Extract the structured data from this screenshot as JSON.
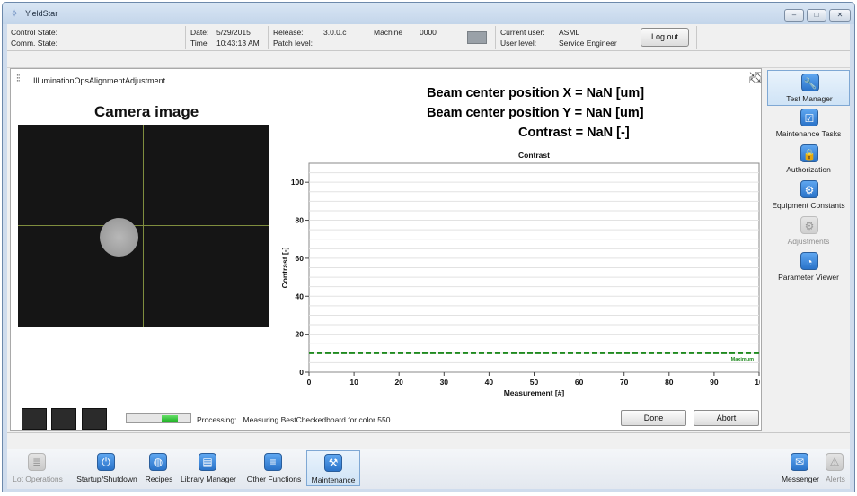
{
  "window": {
    "title": "YieldStar",
    "min_symbol": "–",
    "max_symbol": "□",
    "close_symbol": "✕"
  },
  "status": {
    "control_state_label": "Control State:",
    "comm_state_label": "Comm. State:",
    "date_label": "Date:",
    "date_value": "5/29/2015",
    "time_label": "Time",
    "time_value": "10:43:13 AM",
    "release_label": "Release:",
    "release_value": "3.0.0.c",
    "patch_label": "Patch level:",
    "machine_label": "Machine",
    "machine_value": "0000",
    "current_user_label": "Current user:",
    "current_user_value": "ASML",
    "user_level_label": "User level:",
    "user_level_value": "Service Engineer",
    "logout_label": "Log out"
  },
  "panel": {
    "title": "IlluminationOpsAlignmentAdjustment",
    "icon": "sliders-icon",
    "readouts": {
      "beam_x": "Beam center position X = NaN [um]",
      "beam_y": "Beam center position Y = NaN [um]",
      "contrast": "Contrast = NaN [-]"
    },
    "camera_title": "Camera image",
    "processing_label": "Processing:",
    "processing_text": "Measuring BestCheckedboard for color 550.",
    "progress_fraction": 0.25,
    "done_label": "Done",
    "abort_label": "Abort"
  },
  "chart_data": {
    "type": "line",
    "title": "Contrast",
    "xlabel": "Measurement [#]",
    "ylabel": "Contrast [-]",
    "xlim": [
      0,
      100
    ],
    "ylim": [
      0,
      110
    ],
    "x_ticks": [
      0,
      10,
      20,
      30,
      40,
      50,
      60,
      70,
      80,
      90,
      100
    ],
    "x_tick_labels": [
      "0",
      "10",
      "20",
      "30",
      "40",
      "50",
      "60",
      "70",
      "80",
      "90",
      "10"
    ],
    "y_ticks": [
      0,
      20,
      40,
      60,
      80,
      100
    ],
    "grid": true,
    "series": [],
    "reference_lines": [
      {
        "name": "Maximum",
        "y": 10,
        "style": "dashed",
        "color": "#1f8a1f"
      }
    ]
  },
  "sidebar": {
    "items": [
      {
        "label": "Test Manager",
        "icon": "wrench-icon",
        "glyph": "🔧",
        "active": true,
        "enabled": true
      },
      {
        "label": "Maintenance Tasks",
        "icon": "checkbox-icon",
        "glyph": "☑",
        "active": false,
        "enabled": true
      },
      {
        "label": "Authorization",
        "icon": "lock-icon",
        "glyph": "🔒",
        "active": false,
        "enabled": true
      },
      {
        "label": "Equipment Constants",
        "icon": "gear-icon",
        "glyph": "⚙",
        "active": false,
        "enabled": true
      },
      {
        "label": "Adjustments",
        "icon": "adjustments-icon",
        "glyph": "⚙",
        "active": false,
        "enabled": false
      },
      {
        "label": "Parameter Viewer",
        "icon": "gauge-icon",
        "glyph": "◔",
        "active": false,
        "enabled": true
      }
    ]
  },
  "bottombar": {
    "items": [
      {
        "label": "Lot Operations",
        "icon": "cylinder-icon",
        "glyph": "≣",
        "active": false,
        "enabled": false
      },
      {
        "label": "Startup/Shutdown",
        "icon": "power-icon",
        "glyph": "⏻",
        "active": false,
        "enabled": true
      },
      {
        "label": "Recipes",
        "icon": "globe-icon",
        "glyph": "◍",
        "active": false,
        "enabled": true
      },
      {
        "label": "Library Manager",
        "icon": "library-icon",
        "glyph": "▤",
        "active": false,
        "enabled": true
      },
      {
        "label": "Other Functions",
        "icon": "stack-icon",
        "glyph": "≡",
        "active": false,
        "enabled": true
      },
      {
        "label": "Maintenance",
        "icon": "tools-icon",
        "glyph": "⚒",
        "active": true,
        "enabled": true
      },
      {
        "label": "Messenger",
        "icon": "messenger-icon",
        "glyph": "✉",
        "active": false,
        "enabled": true
      },
      {
        "label": "Alerts",
        "icon": "warning-icon",
        "glyph": "⚠",
        "active": false,
        "enabled": false
      }
    ]
  }
}
